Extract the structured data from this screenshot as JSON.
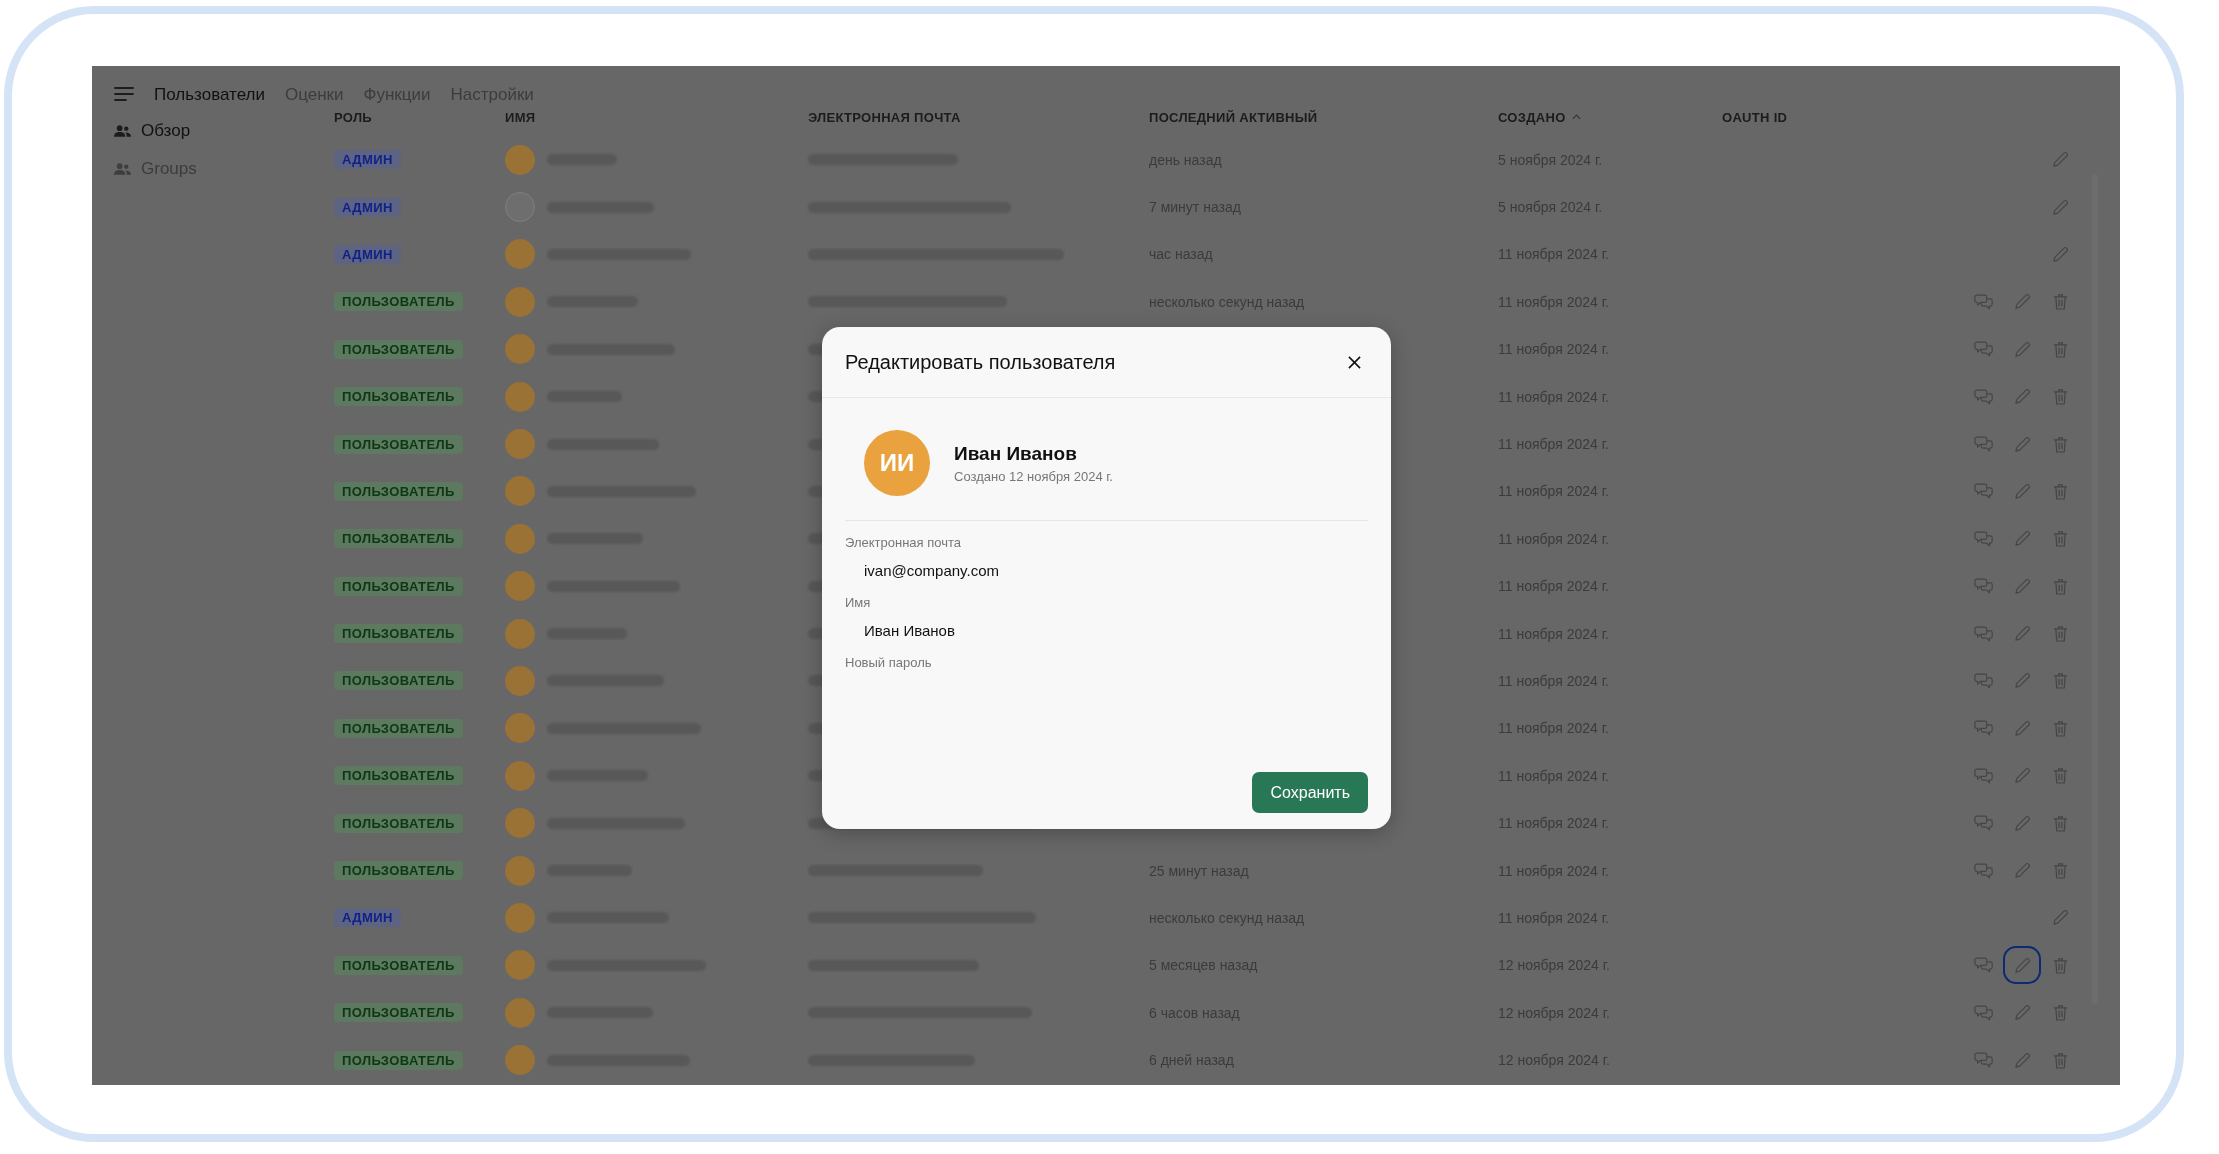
{
  "nav": {
    "tabs": [
      {
        "label": "Пользователи",
        "selected": true
      },
      {
        "label": "Оценки",
        "selected": false
      },
      {
        "label": "Функции",
        "selected": false
      },
      {
        "label": "Настройки",
        "selected": false
      }
    ]
  },
  "sidebar": {
    "items": [
      {
        "label": "Обзор",
        "selected": true
      },
      {
        "label": "Groups",
        "selected": false
      }
    ]
  },
  "table": {
    "columns": [
      {
        "label": "РОЛЬ",
        "sorted": false
      },
      {
        "label": "ИМЯ",
        "sorted": false
      },
      {
        "label": "ЭЛЕКТРОННАЯ ПОЧТА",
        "sorted": false
      },
      {
        "label": "ПОСЛЕДНИЙ АКТИВНЫЙ",
        "sorted": false
      },
      {
        "label": "СОЗДАНО",
        "sorted": true
      },
      {
        "label": "OAUTH ID",
        "sorted": false
      }
    ],
    "rows": [
      {
        "role": "АДМИН",
        "kind": "admin",
        "avatar_empty": false,
        "last_active": "день назад",
        "created": "5 ноября 2024 г.",
        "actions": [
          {
            "kind": "edit"
          }
        ],
        "focused": false
      },
      {
        "role": "АДМИН",
        "kind": "admin",
        "avatar_empty": true,
        "last_active": "7 минут назад",
        "created": "5 ноября 2024 г.",
        "actions": [
          {
            "kind": "edit"
          }
        ],
        "focused": false
      },
      {
        "role": "АДМИН",
        "kind": "admin",
        "avatar_empty": false,
        "last_active": "час назад",
        "created": "11 ноября 2024 г.",
        "actions": [
          {
            "kind": "edit"
          }
        ],
        "focused": false
      },
      {
        "role": "ПОЛЬЗОВАТЕЛЬ",
        "kind": "user",
        "avatar_empty": false,
        "last_active": "несколько секунд назад",
        "created": "11 ноября 2024 г.",
        "actions": [
          {
            "kind": "chat"
          },
          {
            "kind": "edit"
          },
          {
            "kind": "delete"
          }
        ],
        "focused": false
      },
      {
        "role": "ПОЛЬЗОВАТЕЛЬ",
        "kind": "user",
        "avatar_empty": false,
        "created": "11 ноября 2024 г.",
        "actions": [
          {
            "kind": "chat"
          },
          {
            "kind": "edit"
          },
          {
            "kind": "delete"
          }
        ],
        "focused": false
      },
      {
        "role": "ПОЛЬЗОВАТЕЛЬ",
        "kind": "user",
        "avatar_empty": false,
        "created": "11 ноября 2024 г.",
        "actions": [
          {
            "kind": "chat"
          },
          {
            "kind": "edit"
          },
          {
            "kind": "delete"
          }
        ],
        "focused": false
      },
      {
        "role": "ПОЛЬЗОВАТЕЛЬ",
        "kind": "user",
        "avatar_empty": false,
        "created": "11 ноября 2024 г.",
        "actions": [
          {
            "kind": "chat"
          },
          {
            "kind": "edit"
          },
          {
            "kind": "delete"
          }
        ],
        "focused": false
      },
      {
        "role": "ПОЛЬЗОВАТЕЛЬ",
        "kind": "user",
        "avatar_empty": false,
        "created": "11 ноября 2024 г.",
        "actions": [
          {
            "kind": "chat"
          },
          {
            "kind": "edit"
          },
          {
            "kind": "delete"
          }
        ],
        "focused": false
      },
      {
        "role": "ПОЛЬЗОВАТЕЛЬ",
        "kind": "user",
        "avatar_empty": false,
        "created": "11 ноября 2024 г.",
        "actions": [
          {
            "kind": "chat"
          },
          {
            "kind": "edit"
          },
          {
            "kind": "delete"
          }
        ],
        "focused": false
      },
      {
        "role": "ПОЛЬЗОВАТЕЛЬ",
        "kind": "user",
        "avatar_empty": false,
        "created": "11 ноября 2024 г.",
        "actions": [
          {
            "kind": "chat"
          },
          {
            "kind": "edit"
          },
          {
            "kind": "delete"
          }
        ],
        "focused": false
      },
      {
        "role": "ПОЛЬЗОВАТЕЛЬ",
        "kind": "user",
        "avatar_empty": false,
        "created": "11 ноября 2024 г.",
        "actions": [
          {
            "kind": "chat"
          },
          {
            "kind": "edit"
          },
          {
            "kind": "delete"
          }
        ],
        "focused": false
      },
      {
        "role": "ПОЛЬЗОВАТЕЛЬ",
        "kind": "user",
        "avatar_empty": false,
        "created": "11 ноября 2024 г.",
        "actions": [
          {
            "kind": "chat"
          },
          {
            "kind": "edit"
          },
          {
            "kind": "delete"
          }
        ],
        "focused": false
      },
      {
        "role": "ПОЛЬЗОВАТЕЛЬ",
        "kind": "user",
        "avatar_empty": false,
        "created": "11 ноября 2024 г.",
        "actions": [
          {
            "kind": "chat"
          },
          {
            "kind": "edit"
          },
          {
            "kind": "delete"
          }
        ],
        "focused": false
      },
      {
        "role": "ПОЛЬЗОВАТЕЛЬ",
        "kind": "user",
        "avatar_empty": false,
        "created": "11 ноября 2024 г.",
        "actions": [
          {
            "kind": "chat"
          },
          {
            "kind": "edit"
          },
          {
            "kind": "delete"
          }
        ],
        "focused": false
      },
      {
        "role": "ПОЛЬЗОВАТЕЛЬ",
        "kind": "user",
        "avatar_empty": false,
        "created": "11 ноября 2024 г.",
        "actions": [
          {
            "kind": "chat"
          },
          {
            "kind": "edit"
          },
          {
            "kind": "delete"
          }
        ],
        "focused": false
      },
      {
        "role": "ПОЛЬЗОВАТЕЛЬ",
        "kind": "user",
        "avatar_empty": false,
        "last_active": "25 минут назад",
        "created": "11 ноября 2024 г.",
        "actions": [
          {
            "kind": "chat"
          },
          {
            "kind": "edit"
          },
          {
            "kind": "delete"
          }
        ],
        "focused": false
      },
      {
        "role": "АДМИН",
        "kind": "admin",
        "avatar_empty": false,
        "last_active": "несколько секунд назад",
        "created": "11 ноября 2024 г.",
        "actions": [
          {
            "kind": "edit"
          }
        ],
        "focused": false
      },
      {
        "role": "ПОЛЬЗОВАТЕЛЬ",
        "kind": "user",
        "avatar_empty": false,
        "last_active": "5 месяцев назад",
        "created": "12 ноября 2024 г.",
        "actions": [
          {
            "kind": "chat"
          },
          {
            "kind": "edit"
          },
          {
            "kind": "delete"
          }
        ],
        "focused": true
      },
      {
        "role": "ПОЛЬЗОВАТЕЛЬ",
        "kind": "user",
        "avatar_empty": false,
        "last_active": "6 часов назад",
        "created": "12 ноября 2024 г.",
        "actions": [
          {
            "kind": "chat"
          },
          {
            "kind": "edit"
          },
          {
            "kind": "delete"
          }
        ],
        "focused": false
      },
      {
        "role": "ПОЛЬЗОВАТЕЛЬ",
        "kind": "user",
        "avatar_empty": false,
        "last_active": "6 дней назад",
        "created": "12 ноября 2024 г.",
        "actions": [
          {
            "kind": "chat"
          },
          {
            "kind": "edit"
          },
          {
            "kind": "delete"
          }
        ],
        "focused": false
      }
    ]
  },
  "modal": {
    "title": "Редактировать пользователя",
    "initials": "ИИ",
    "name": "Иван Иванов",
    "created": "Создано 12 ноября 2024 г.",
    "fields": [
      {
        "label": "Электронная почта",
        "value": "ivan@company.com"
      },
      {
        "label": "Имя",
        "value": "Иван Иванов"
      },
      {
        "label": "Новый пароль"
      }
    ],
    "button": "Сохранить"
  }
}
